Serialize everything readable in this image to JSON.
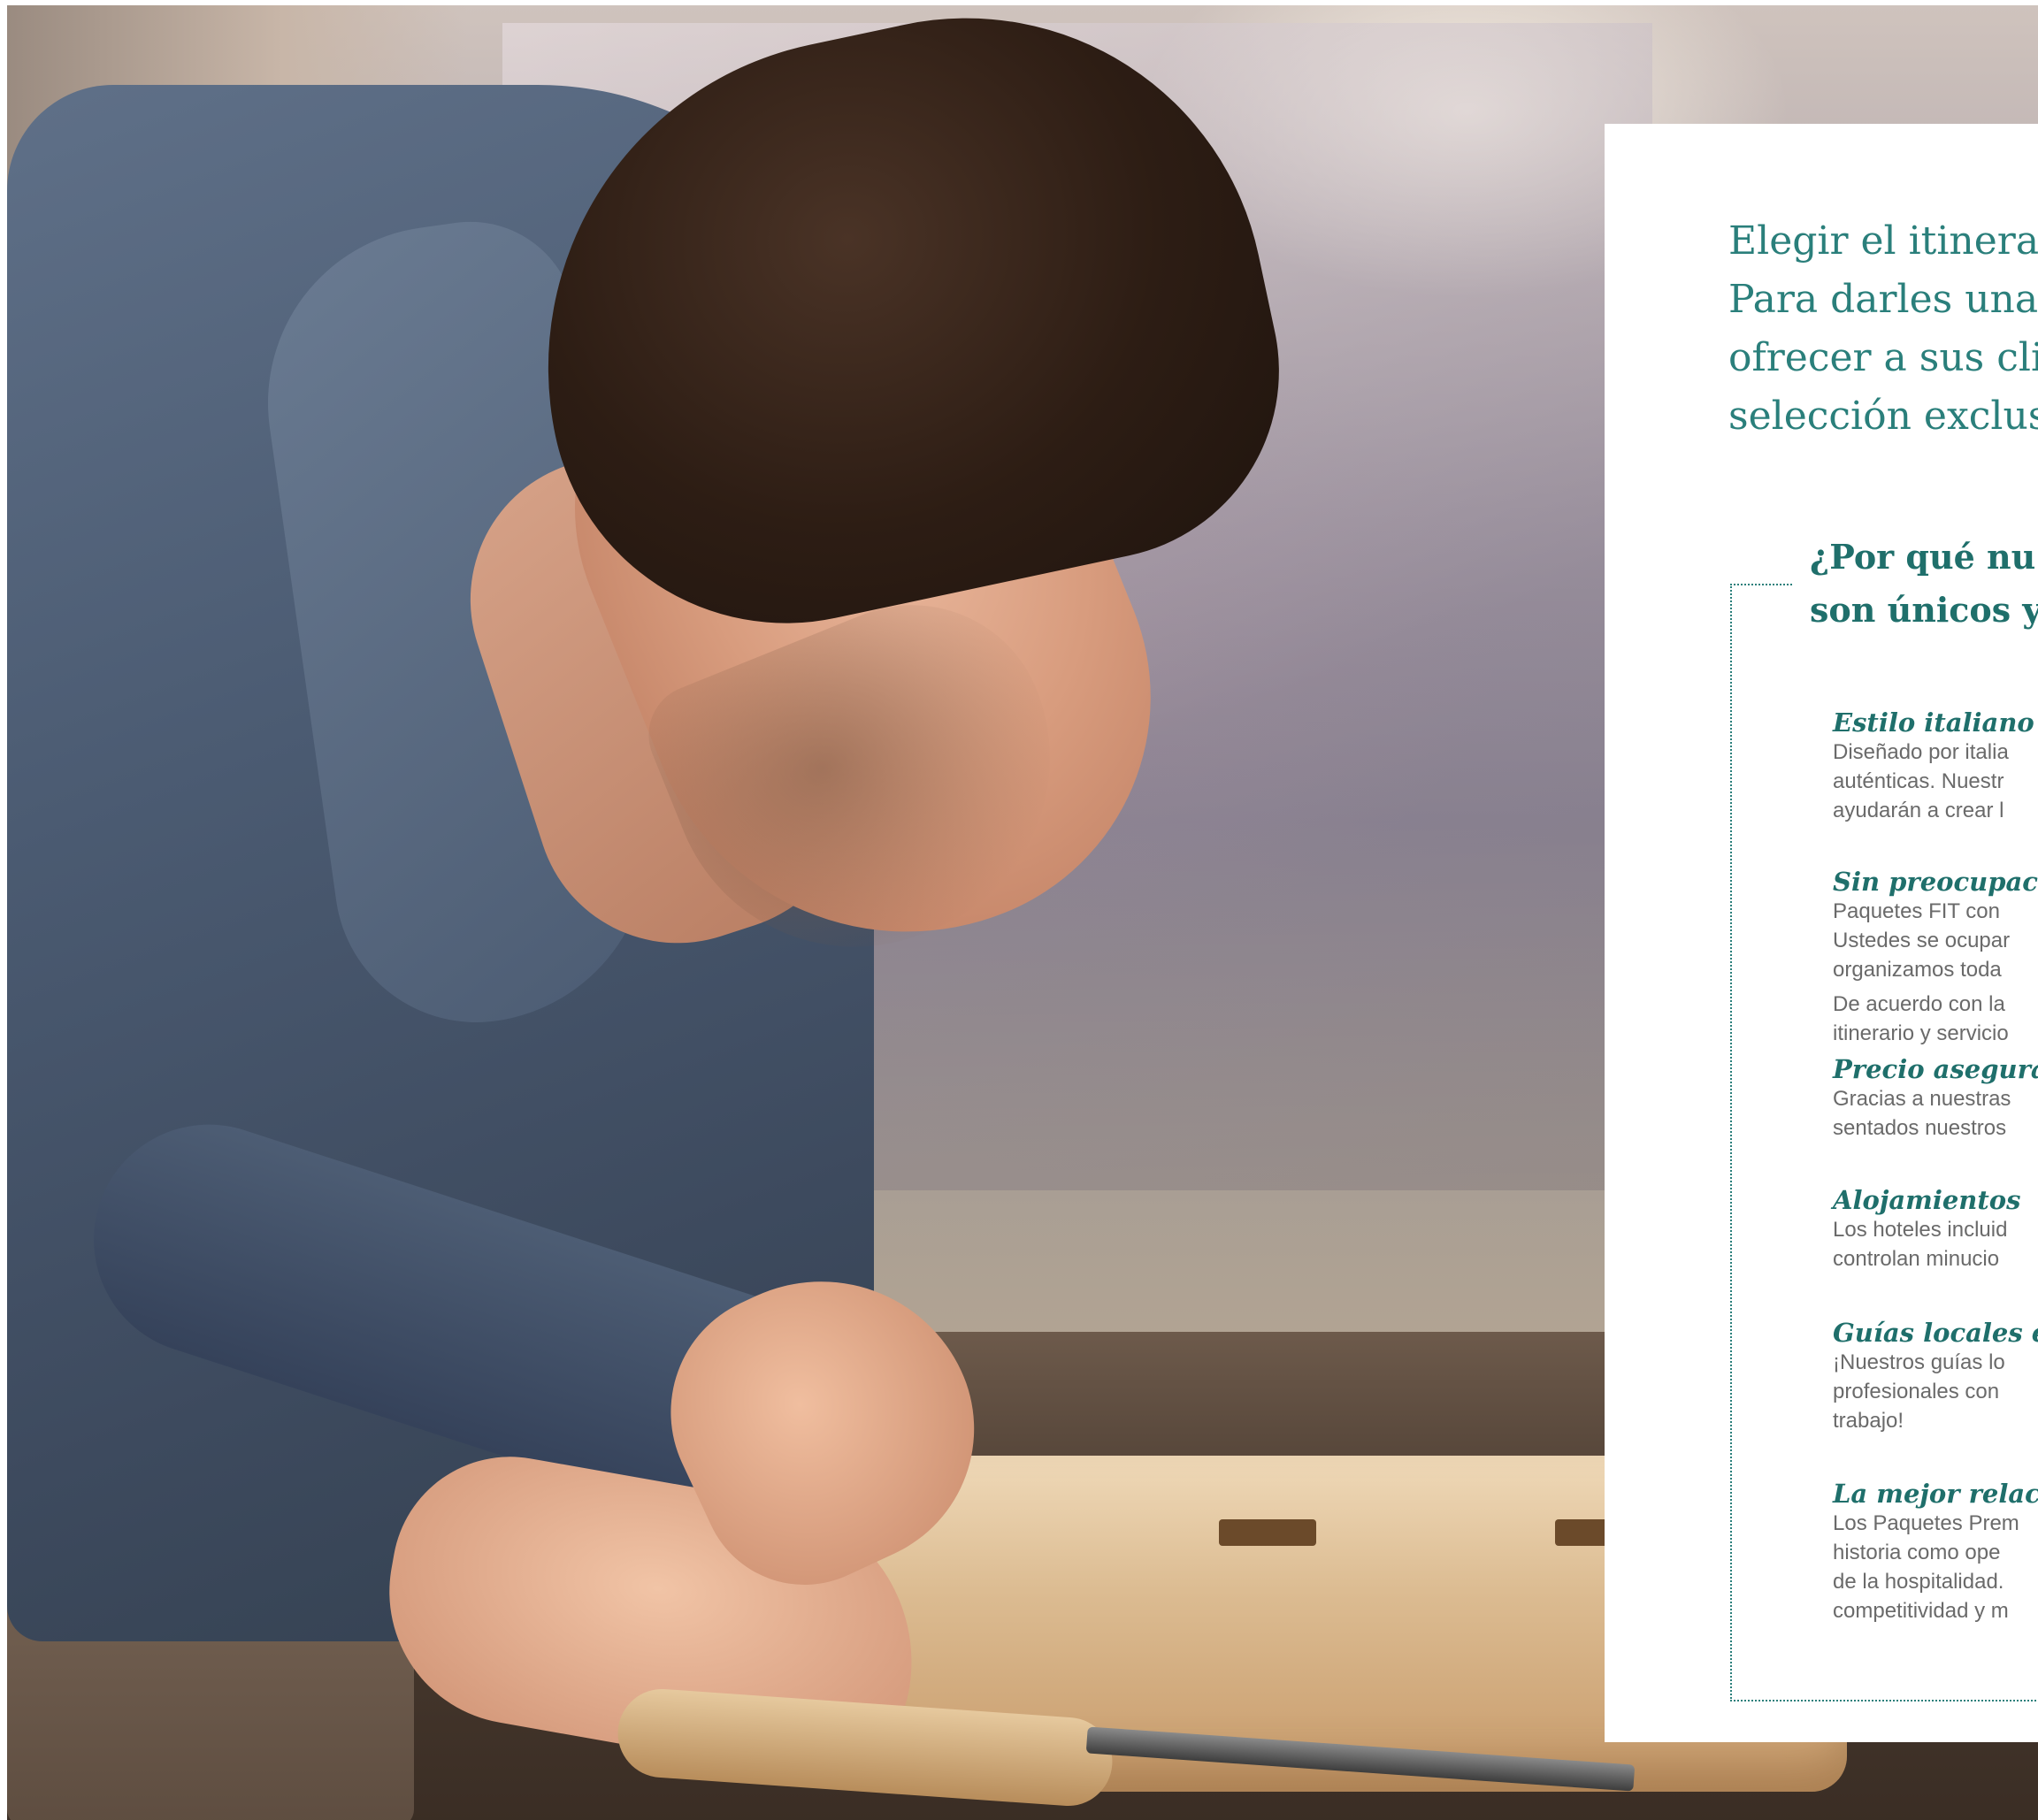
{
  "intro": [
    "Elegir el itinerario",
    "Para darles una ide",
    "ofrecer a sus client",
    "selección exclusiva"
  ],
  "box_title": [
    "¿Por qué nu",
    "son únicos y"
  ],
  "features": [
    {
      "title": "Estilo italiano",
      "lines": [
        "Diseñado por italia",
        "auténticas. Nuestr",
        "ayudarán a crear l"
      ]
    },
    {
      "title": "Sin preocupacione",
      "lines": [
        "Paquetes FIT con",
        "Ustedes se ocupar",
        "organizamos toda",
        "De acuerdo con la",
        "itinerario y servicio"
      ]
    },
    {
      "title": "Precio asegurado",
      "lines": [
        "Gracias a nuestras",
        "sentados nuestros"
      ]
    },
    {
      "title": "Alojamientos",
      "lines": [
        "Los hoteles incluid",
        "controlan minucio"
      ]
    },
    {
      "title": "Guías locales expe",
      "lines": [
        "¡Nuestros guías lo",
        "profesionales con",
        "trabajo!"
      ]
    },
    {
      "title": "La mejor relación",
      "lines": [
        "Los Paquetes Prem",
        "historia como ope",
        "de la hospitalidad.",
        "competitividad y m"
      ]
    }
  ],
  "colors": {
    "accent": "#2a7f7b",
    "body_text": "#6a6a6a",
    "panel": "#ffffff"
  }
}
